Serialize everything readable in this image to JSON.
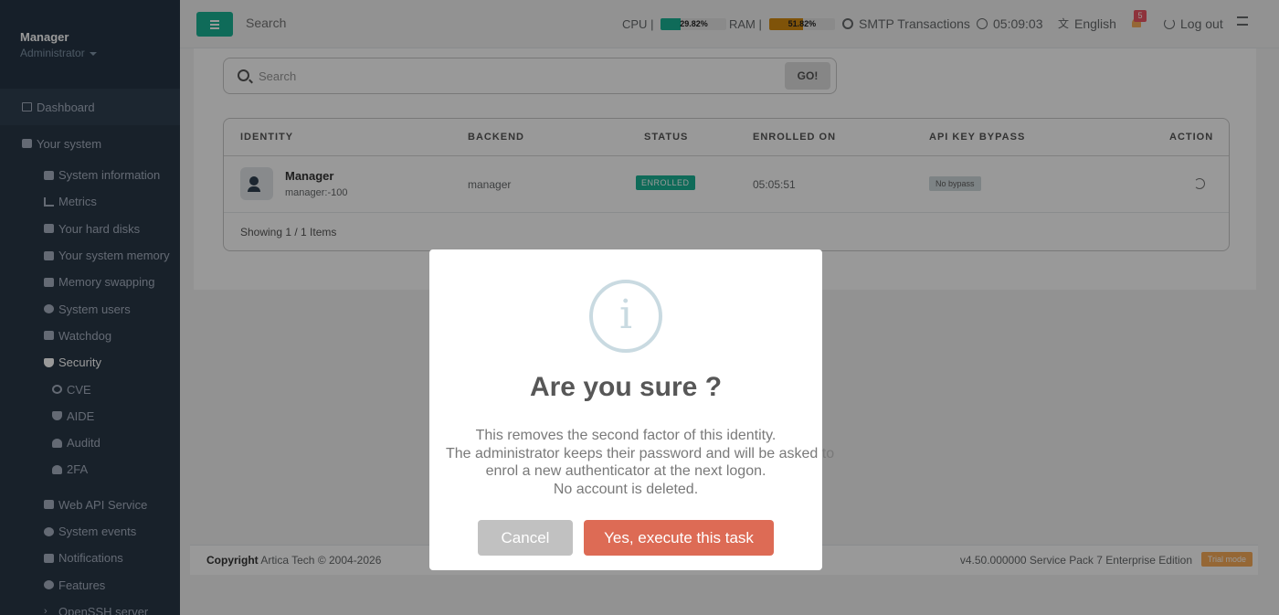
{
  "sidebar": {
    "profile": {
      "name": "Manager",
      "role": "Administrator"
    },
    "dashboard": "Dashboard",
    "group_label": "Your system",
    "items": [
      {
        "label": "System information",
        "icon": "server-icon"
      },
      {
        "label": "Metrics",
        "icon": "chart-icon"
      },
      {
        "label": "Your hard disks",
        "icon": "hdd-icon"
      },
      {
        "label": "Your system memory",
        "icon": "memory-icon"
      },
      {
        "label": "Memory swapping",
        "icon": "swap-icon"
      },
      {
        "label": "System users",
        "icon": "users-icon"
      },
      {
        "label": "Watchdog",
        "icon": "dog-icon"
      },
      {
        "label": "Security",
        "icon": "shield-icon",
        "active": true
      }
    ],
    "security_items": [
      {
        "label": "CVE",
        "icon": "radiation-icon"
      },
      {
        "label": "AIDE",
        "icon": "shield-half-icon"
      },
      {
        "label": "Auditd",
        "icon": "user-lock-icon"
      },
      {
        "label": "2FA",
        "icon": "user-lock-icon"
      }
    ],
    "more_items": [
      {
        "label": "Web API Service",
        "icon": "api-icon"
      },
      {
        "label": "System events",
        "icon": "eye-icon"
      },
      {
        "label": "Notifications",
        "icon": "envelope-icon"
      },
      {
        "label": "Features",
        "icon": "gear-icon"
      },
      {
        "label": "OpenSSH server",
        "icon": "chevron-right-icon"
      }
    ]
  },
  "topbar": {
    "search_placeholder": "Search",
    "cpu_label": "CPU",
    "cpu_sep": "|",
    "cpu_pct": "29.82%",
    "cpu_value": 29.82,
    "ram_label": "RAM",
    "ram_sep": "|",
    "ram_pct": "51.82%",
    "ram_value": 51.82,
    "smtp": "SMTP Transactions",
    "time": "05:09:03",
    "language": "English",
    "notif_count": "5",
    "logout": "Log out"
  },
  "content": {
    "search_placeholder": "Search",
    "go_label": "GO!",
    "columns": [
      "IDENTITY",
      "BACKEND",
      "STATUS",
      "ENROLLED ON",
      "API KEY BYPASS",
      "ACTION"
    ],
    "row": {
      "name": "Manager",
      "sub": "manager:-100",
      "backend": "manager",
      "status": "ENROLLED",
      "enrolled": "05:05:51",
      "bypass": "No bypass"
    },
    "showing": "Showing 1 / 1 Items"
  },
  "footer": {
    "copyright_bold": "Copyright",
    "copyright_rest": " Artica Tech © 2004-2026",
    "version": "v4.50.000000 Service Pack 7 Enterprise Edition",
    "trial": "Trial mode"
  },
  "modal": {
    "icon_glyph": "i",
    "title": "Are you sure ?",
    "lines": [
      "This removes the second factor of this identity.",
      "The administrator keeps their password and will be asked to",
      "enrol a new authenticator at the next logon.",
      "No account is deleted."
    ],
    "cancel": "Cancel",
    "confirm": "Yes, execute this task"
  },
  "colors": {
    "accent": "#1ab394",
    "sidebar": "#2f4050",
    "confirm": "#dd6b55",
    "cpu_bar": "#1ab394",
    "ram_bar": "#d48a0f"
  }
}
